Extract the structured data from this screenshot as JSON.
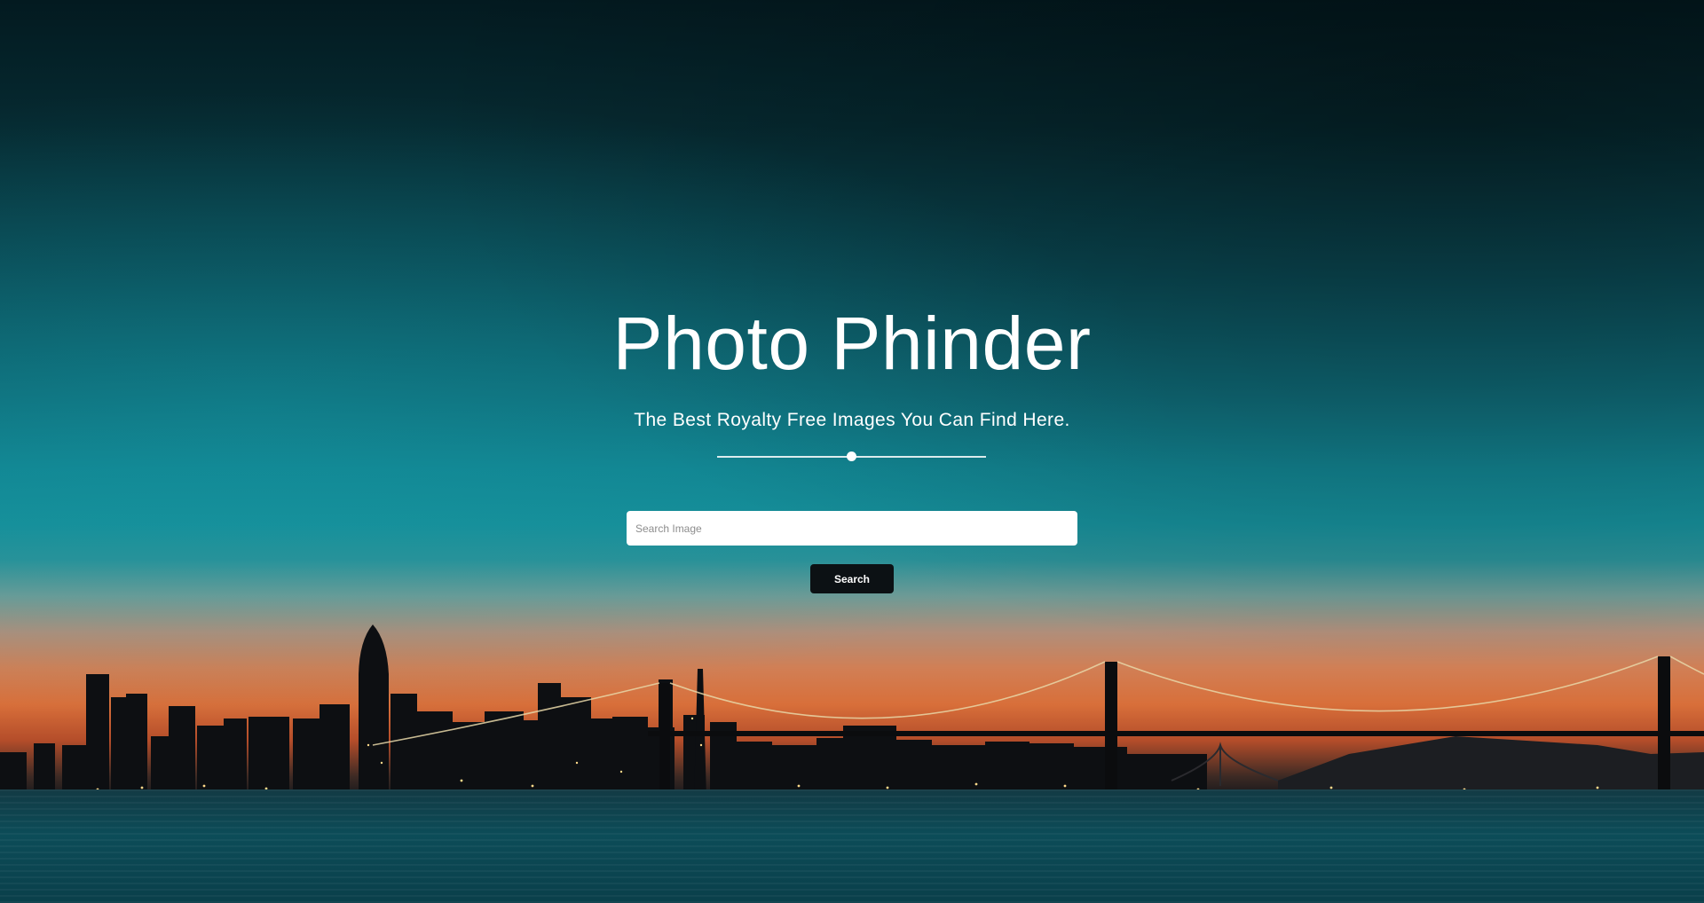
{
  "hero": {
    "title": "Photo Phinder",
    "subtitle": "The Best Royalty Free Images You Can Find Here."
  },
  "search": {
    "placeholder": "Search Image",
    "value": "",
    "button_label": "Search"
  },
  "colors": {
    "text": "#ffffff",
    "button_bg": "#0c1114",
    "input_bg": "#ffffff",
    "placeholder": "#8d8d8d"
  },
  "background": {
    "description_icon": "city-skyline-bridge-sunset-image"
  }
}
